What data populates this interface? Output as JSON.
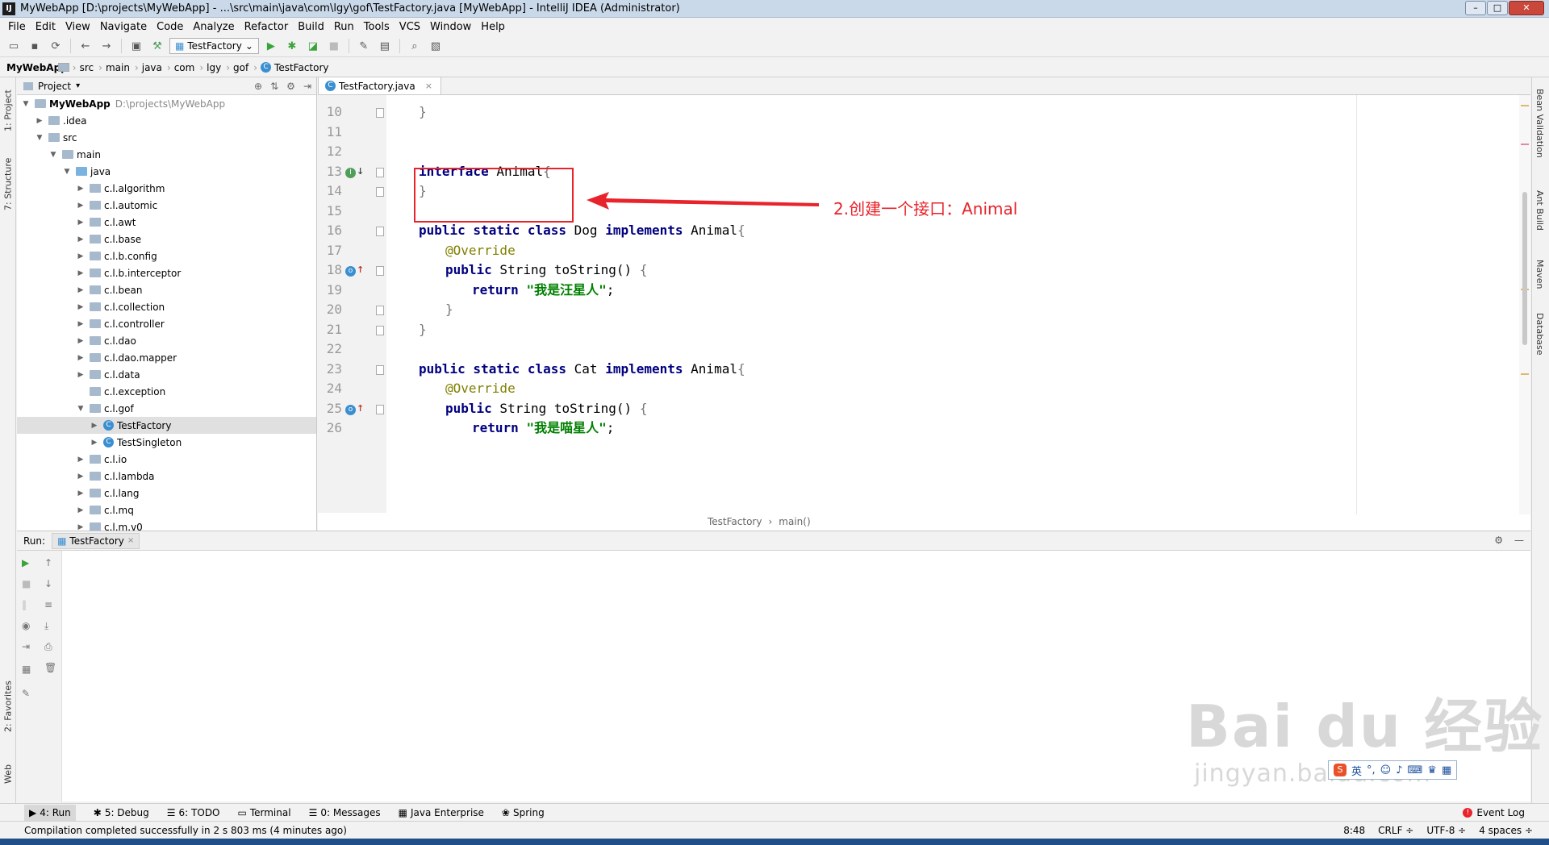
{
  "window": {
    "title": "MyWebApp [D:\\projects\\MyWebApp] - ...\\src\\main\\java\\com\\lgy\\gof\\TestFactory.java [MyWebApp] - IntelliJ IDEA (Administrator)",
    "app_icon": "IJ"
  },
  "menu": [
    "File",
    "Edit",
    "View",
    "Navigate",
    "Code",
    "Analyze",
    "Refactor",
    "Build",
    "Run",
    "Tools",
    "VCS",
    "Window",
    "Help"
  ],
  "toolbar": {
    "run_config": "TestFactory"
  },
  "breadcrumbs": [
    "MyWebApp",
    "src",
    "main",
    "java",
    "com",
    "lgy",
    "gof",
    "TestFactory"
  ],
  "left_strip": {
    "project": "1: Project",
    "structure": "7: Structure",
    "favorites": "2: Favorites",
    "web": "Web"
  },
  "right_strip": [
    "Bean Validation",
    "Ant Build",
    "Maven",
    "Database"
  ],
  "project": {
    "header": "Project",
    "tree": [
      {
        "label": "MyWebApp",
        "path": "D:\\projects\\MyWebApp",
        "indent": 0,
        "open": true,
        "type": "module"
      },
      {
        "label": ".idea",
        "indent": 1,
        "open": false,
        "type": "folder"
      },
      {
        "label": "src",
        "indent": 1,
        "open": true,
        "type": "folder"
      },
      {
        "label": "main",
        "indent": 2,
        "open": true,
        "type": "folder"
      },
      {
        "label": "java",
        "indent": 3,
        "open": true,
        "type": "java"
      },
      {
        "label": "c.l.algorithm",
        "indent": 4,
        "open": false,
        "type": "folder"
      },
      {
        "label": "c.l.automic",
        "indent": 4,
        "open": false,
        "type": "folder"
      },
      {
        "label": "c.l.awt",
        "indent": 4,
        "open": false,
        "type": "folder"
      },
      {
        "label": "c.l.base",
        "indent": 4,
        "open": false,
        "type": "folder"
      },
      {
        "label": "c.l.b.config",
        "indent": 4,
        "open": false,
        "type": "folder"
      },
      {
        "label": "c.l.b.interceptor",
        "indent": 4,
        "open": false,
        "type": "folder"
      },
      {
        "label": "c.l.bean",
        "indent": 4,
        "open": false,
        "type": "folder"
      },
      {
        "label": "c.l.collection",
        "indent": 4,
        "open": false,
        "type": "folder"
      },
      {
        "label": "c.l.controller",
        "indent": 4,
        "open": false,
        "type": "folder"
      },
      {
        "label": "c.l.dao",
        "indent": 4,
        "open": false,
        "type": "folder"
      },
      {
        "label": "c.l.dao.mapper",
        "indent": 4,
        "open": false,
        "type": "folder"
      },
      {
        "label": "c.l.data",
        "indent": 4,
        "open": false,
        "type": "folder"
      },
      {
        "label": "c.l.exception",
        "indent": 4,
        "open": null,
        "type": "folder"
      },
      {
        "label": "c.l.gof",
        "indent": 4,
        "open": true,
        "type": "folder"
      },
      {
        "label": "TestFactory",
        "indent": 5,
        "open": false,
        "type": "class",
        "selected": true
      },
      {
        "label": "TestSingleton",
        "indent": 5,
        "open": false,
        "type": "class"
      },
      {
        "label": "c.l.io",
        "indent": 4,
        "open": false,
        "type": "folder"
      },
      {
        "label": "c.l.lambda",
        "indent": 4,
        "open": false,
        "type": "folder"
      },
      {
        "label": "c.l.lang",
        "indent": 4,
        "open": false,
        "type": "folder"
      },
      {
        "label": "c.l.mq",
        "indent": 4,
        "open": false,
        "type": "folder"
      },
      {
        "label": "c.l.m.v0",
        "indent": 4,
        "open": false,
        "type": "folder"
      }
    ]
  },
  "editor": {
    "tab": "TestFactory.java",
    "lines": [
      {
        "n": "10",
        "indent": 0,
        "tokens": [
          [
            "brace",
            "}"
          ]
        ]
      },
      {
        "n": "11",
        "indent": 0,
        "tokens": []
      },
      {
        "n": "12",
        "indent": 0,
        "tokens": []
      },
      {
        "n": "13",
        "indent": 0,
        "tokens": [
          [
            "kw",
            "interface"
          ],
          [
            "plain",
            " Animal"
          ],
          [
            "brace",
            "{"
          ]
        ]
      },
      {
        "n": "14",
        "indent": 0,
        "tokens": [
          [
            "brace",
            "}"
          ]
        ]
      },
      {
        "n": "15",
        "indent": 0,
        "tokens": []
      },
      {
        "n": "16",
        "indent": 0,
        "tokens": [
          [
            "kw",
            "public static class"
          ],
          [
            "plain",
            " Dog "
          ],
          [
            "kw",
            "implements"
          ],
          [
            "plain",
            " Animal"
          ],
          [
            "brace",
            "{"
          ]
        ]
      },
      {
        "n": "17",
        "indent": 1,
        "tokens": [
          [
            "ann",
            "@Override"
          ]
        ]
      },
      {
        "n": "18",
        "indent": 1,
        "tokens": [
          [
            "kw",
            "public"
          ],
          [
            "plain",
            " String toString() "
          ],
          [
            "brace",
            "{"
          ]
        ]
      },
      {
        "n": "19",
        "indent": 2,
        "tokens": [
          [
            "kw",
            "return"
          ],
          [
            "plain",
            " "
          ],
          [
            "str",
            "\"我是汪星人\""
          ],
          [
            "plain",
            ";"
          ]
        ]
      },
      {
        "n": "20",
        "indent": 1,
        "tokens": [
          [
            "brace",
            "}"
          ]
        ]
      },
      {
        "n": "21",
        "indent": 0,
        "tokens": [
          [
            "brace",
            "}"
          ]
        ]
      },
      {
        "n": "22",
        "indent": 0,
        "tokens": []
      },
      {
        "n": "23",
        "indent": 0,
        "tokens": [
          [
            "kw",
            "public static class"
          ],
          [
            "plain",
            " Cat "
          ],
          [
            "kw",
            "implements"
          ],
          [
            "plain",
            " Animal"
          ],
          [
            "brace",
            "{"
          ]
        ]
      },
      {
        "n": "24",
        "indent": 1,
        "tokens": [
          [
            "ann",
            "@Override"
          ]
        ]
      },
      {
        "n": "25",
        "indent": 1,
        "tokens": [
          [
            "kw",
            "public"
          ],
          [
            "plain",
            " String toString() "
          ],
          [
            "brace",
            "{"
          ]
        ]
      },
      {
        "n": "26",
        "indent": 2,
        "tokens": [
          [
            "kw",
            "return"
          ],
          [
            "plain",
            " "
          ],
          [
            "str",
            "\"我是喵星人\""
          ],
          [
            "plain",
            ";"
          ]
        ]
      }
    ],
    "gutter_marks": [
      {
        "line": "13",
        "icon": "I",
        "arrow": "↓",
        "kind": "implemented"
      },
      {
        "line": "18",
        "icon": "o",
        "arrow": "↑",
        "kind": "override"
      },
      {
        "line": "25",
        "icon": "o",
        "arrow": "↑",
        "kind": "override"
      }
    ],
    "breadcrumb": [
      "TestFactory",
      "main()"
    ]
  },
  "annotation": {
    "text": "2.创建一个接口：Animal",
    "color": "#e8232b"
  },
  "run": {
    "label": "Run:",
    "tab": "TestFactory"
  },
  "bottom_tabs": [
    {
      "label": "4: Run",
      "active": true,
      "icon": "▶"
    },
    {
      "label": "5: Debug",
      "icon": "✱"
    },
    {
      "label": "6: TODO",
      "icon": "☰"
    },
    {
      "label": "Terminal",
      "icon": "▭"
    },
    {
      "label": "0: Messages",
      "icon": "☰"
    },
    {
      "label": "Java Enterprise",
      "icon": "▦"
    },
    {
      "label": "Spring",
      "icon": "❀"
    }
  ],
  "event_log": "Event Log",
  "status": {
    "message": "Compilation completed successfully in 2 s 803 ms (4 minutes ago)",
    "position": "8:48",
    "line_sep": "CRLF ÷",
    "encoding": "UTF-8 ÷",
    "indent": "4 spaces ÷"
  },
  "watermark": {
    "main": "Bai du 经验",
    "sub": "jingyan.baidu.com"
  },
  "ime": {
    "label": "英"
  }
}
